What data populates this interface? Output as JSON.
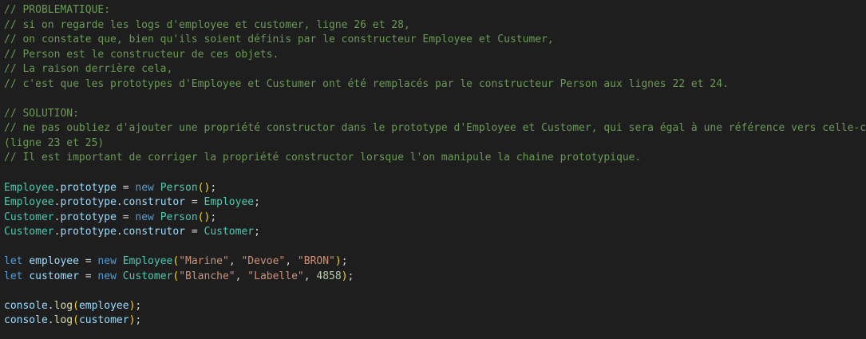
{
  "comments": {
    "c1": "// PROBLEMATIQUE:",
    "c2": "// si on regarde les logs d'employee et customer, ligne 26 et 28,",
    "c3": "// on constate que, bien qu'ils soient définis par le constructeur Employee et Custumer,",
    "c4": "// Person est le constructeur de ces objets.",
    "c5": "// La raison derrière cela,",
    "c6": "// c'est que les prototypes d'Employee et Custumer ont été remplacés par le constructeur Person aux lignes 22 et 24.",
    "s1": "// SOLUTION:",
    "s2a": "// ne pas oubliez d'ajouter une propriété constructor dans le prototype d'Employee et Customer, qui sera égal à une référence vers celle-ci.",
    "s2b": "(ligne 23 et 25)",
    "s3": "// Il est important de corriger la propriété constructor lorsque l'on manipule la chaine prototypique."
  },
  "code": {
    "employee_cls": "Employee",
    "customer_cls": "Customer",
    "person_cls": "Person",
    "prototype": "prototype",
    "construtor": "construtor",
    "new_kw": "new",
    "let_kw": "let",
    "employee_var": "employee",
    "customer_var": "customer",
    "console": "console",
    "log": "log",
    "marine": "\"Marine\"",
    "devoe": "\"Devoe\"",
    "bron": "\"BRON\"",
    "blanche": "\"Blanche\"",
    "labelle": "\"Labelle\"",
    "num": "4858"
  },
  "colors": {
    "background": "#1e1e1e",
    "comment": "#6a9955",
    "class": "#4ec9b0",
    "property": "#9cdcfe",
    "keyword": "#569cd6",
    "function": "#dcdcaa",
    "string": "#ce9178",
    "number": "#b5cea8"
  }
}
